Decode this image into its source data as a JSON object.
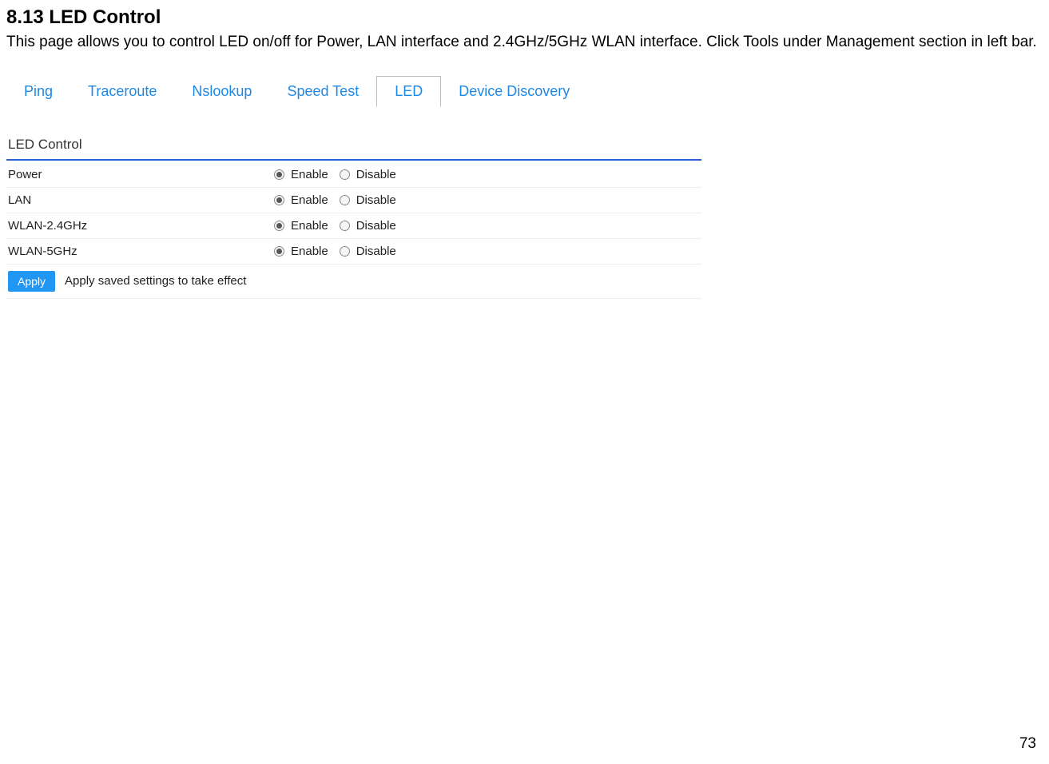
{
  "heading": "8.13 LED Control",
  "description": "This page allows you to control LED on/off for Power, LAN interface and 2.4GHz/5GHz WLAN interface. Click Tools under Management section in left bar.",
  "tabs": [
    {
      "label": "Ping",
      "active": false
    },
    {
      "label": "Traceroute",
      "active": false
    },
    {
      "label": "Nslookup",
      "active": false
    },
    {
      "label": "Speed Test",
      "active": false
    },
    {
      "label": "LED",
      "active": true
    },
    {
      "label": "Device Discovery",
      "active": false
    }
  ],
  "panel_title": "LED Control",
  "options": {
    "enable": "Enable",
    "disable": "Disable"
  },
  "rows": [
    {
      "label": "Power",
      "selected": "enable"
    },
    {
      "label": "LAN",
      "selected": "enable"
    },
    {
      "label": "WLAN-2.4GHz",
      "selected": "enable"
    },
    {
      "label": "WLAN-5GHz",
      "selected": "enable"
    }
  ],
  "apply_button": "Apply",
  "apply_text": "Apply saved settings to take effect",
  "page_number": "73"
}
